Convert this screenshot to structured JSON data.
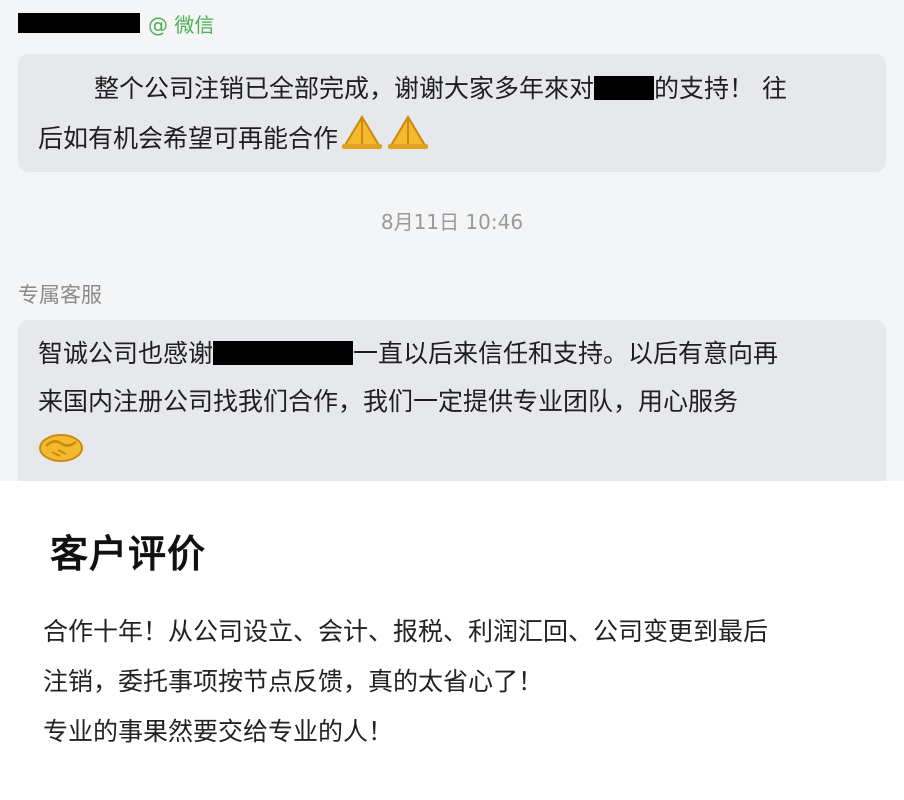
{
  "chat": {
    "sender_tag": "@ 微信",
    "message1": {
      "part1": "整个公司注销已全部完成，谢谢大家多年來对",
      "part2": "的支持！ 往",
      "line2": "后如有机会希望可再能合作"
    },
    "timestamp": "8月11日 10:46",
    "agent_name": "专属客服",
    "message2": {
      "part1": "智诚公司也感谢",
      "part2": "一直以后来信任和支持。以后有意向再",
      "line2": "来国内注册公司找我们合作，我们一定提供专业团队，用心服务"
    }
  },
  "review": {
    "title": "客户评价",
    "lines": [
      "合作十年！从公司设立、会计、报税、利润汇回、公司变更到最后",
      "注销，委托事项按节点反馈，真的太省心了！",
      "专业的事果然要交给专业的人！"
    ]
  },
  "icons": [
    "pray-hands-icon",
    "pray-hands-icon",
    "handshake-icon"
  ],
  "colors": {
    "wechat_green": "#4caf50",
    "bubble": "#e6e8ec",
    "chat_bg": "#f4f5f7"
  }
}
